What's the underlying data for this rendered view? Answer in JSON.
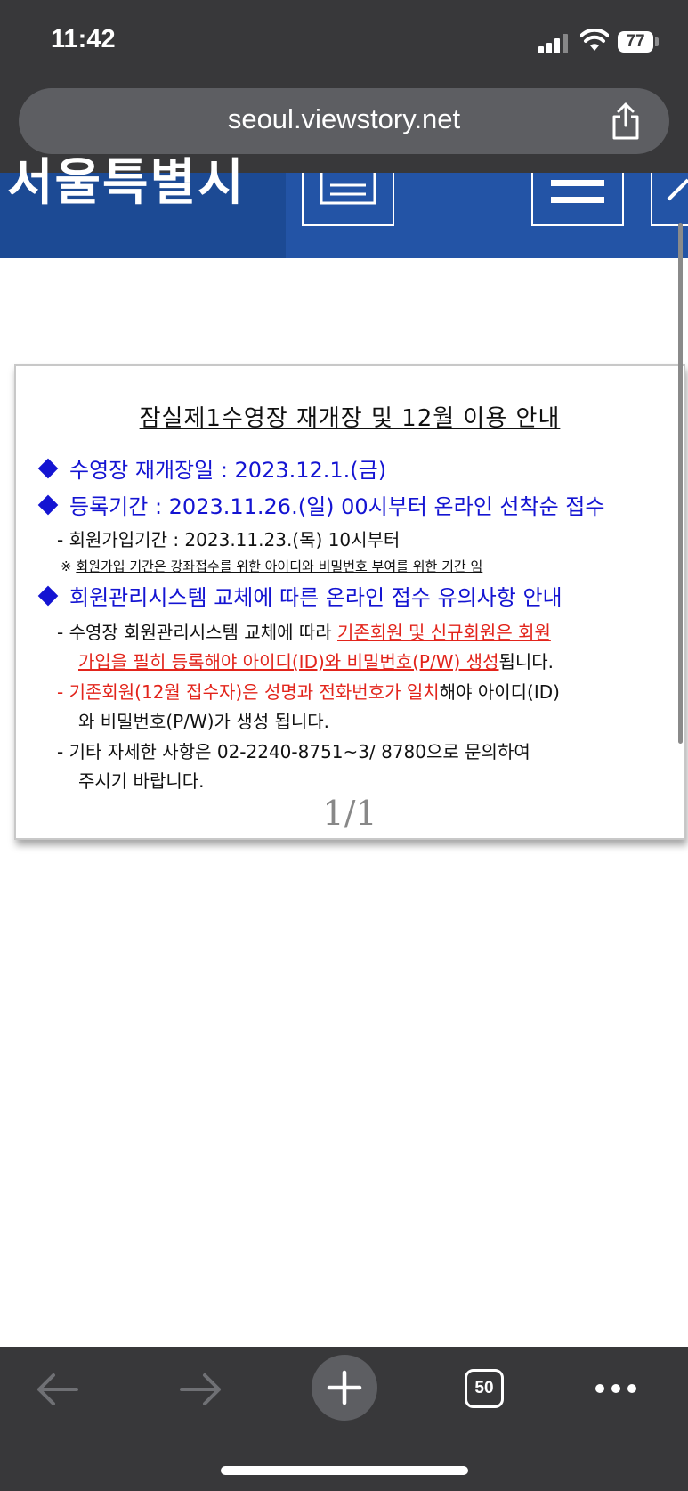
{
  "status_bar": {
    "time": "11:42",
    "battery": "77"
  },
  "browser": {
    "url": "seoul.viewstory.net",
    "tab_count": "50"
  },
  "site": {
    "logo_text": "서울특별시"
  },
  "notice": {
    "title": "잠실제1수영장 재개장 및 12월 이용 안내",
    "line1": "수영장 재개장일 : 2023.12.1.(금)",
    "line2": "등록기간 : 2023.11.26.(일) 00시부터 온라인 선착순 접수",
    "line3": "- 회원가입기간 : 2023.11.23.(목) 10시부터",
    "line4_mark": "※",
    "line4": "회원가입 기간은 강좌접수를 위한 아이디와 비밀번호 부여를 위한 기간 임",
    "line5": "회원관리시스템 교체에 따른 온라인 접수 유의사항 안내",
    "line6a": "- 수영장 회원관리시스템 교체에 따라 ",
    "line6b": "기존회원 및 신규회원은 회원",
    "line7a": "가입을 필히 등록해야 아이디(ID)와 비밀번호(P/W) 생성",
    "line7b": "됩니다.",
    "line8a": "- 기존회원(12월 접수자)은 성명과 전화번호가 일치",
    "line8b": "해야 아이디(ID)",
    "line9": "와 비밀번호(P/W)가 생성 됩니다.",
    "line10": "- 기타 자세한 사항은 02-2240-8751~3/ 8780으로 문의하여",
    "line11": "주시기 바랍니다.",
    "page_indicator": "1/1"
  },
  "colors": {
    "header_blue": "#2354a6",
    "notice_blue": "#1414d2",
    "notice_red": "#e2241b",
    "chrome": "#38383a"
  }
}
